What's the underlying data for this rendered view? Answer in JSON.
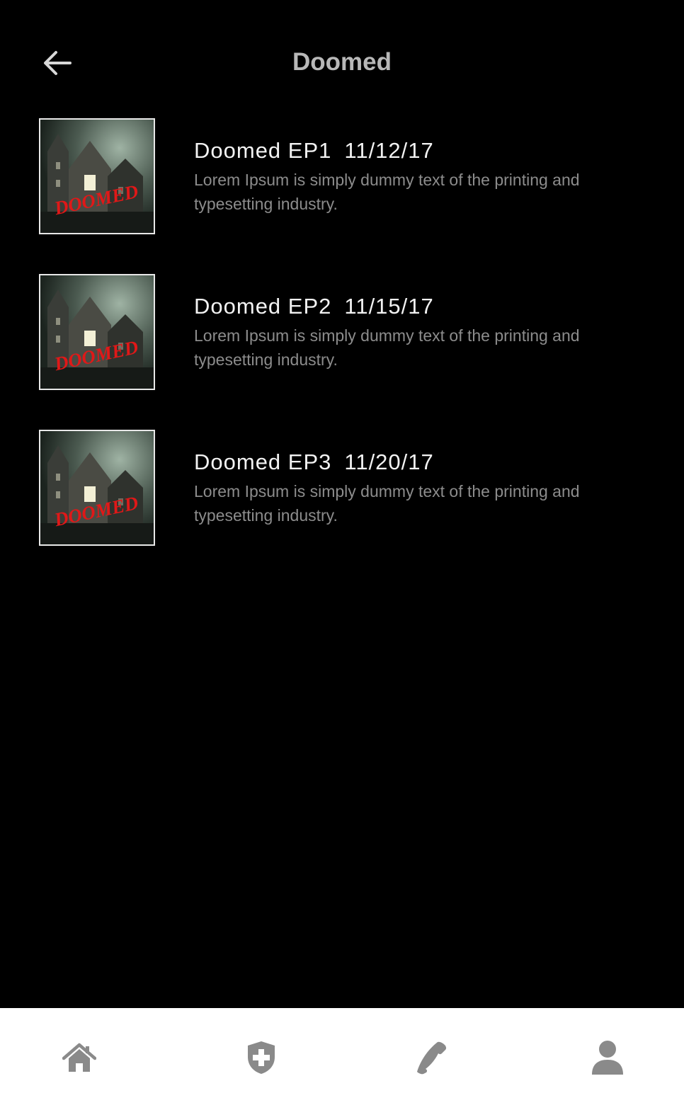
{
  "header": {
    "title": "Doomed",
    "back_icon": "arrow-left-icon"
  },
  "episodes": [
    {
      "title": "Doomed EP1",
      "date": "11/12/17",
      "description": "Lorem Ipsum is simply dummy text of the printing and typesetting industry.",
      "thumbnail_text": "DOOMED"
    },
    {
      "title": "Doomed EP2",
      "date": "11/15/17",
      "description": "Lorem Ipsum is simply dummy text of the printing and typesetting industry.",
      "thumbnail_text": "DOOMED"
    },
    {
      "title": "Doomed EP3",
      "date": "11/20/17",
      "description": "Lorem Ipsum is simply dummy text of the printing and typesetting industry.",
      "thumbnail_text": "DOOMED"
    }
  ],
  "tabbar": {
    "items": [
      {
        "icon": "home-icon"
      },
      {
        "icon": "shield-plus-icon"
      },
      {
        "icon": "phone-icon"
      },
      {
        "icon": "user-icon"
      }
    ]
  },
  "colors": {
    "background": "#000000",
    "title": "#b8b8b8",
    "episode_title": "#f2f2f2",
    "description": "#8c8c8c",
    "tabbar_bg": "#ffffff",
    "tab_icon": "#8a8a8a",
    "thumbnail_logo": "#e01818"
  }
}
